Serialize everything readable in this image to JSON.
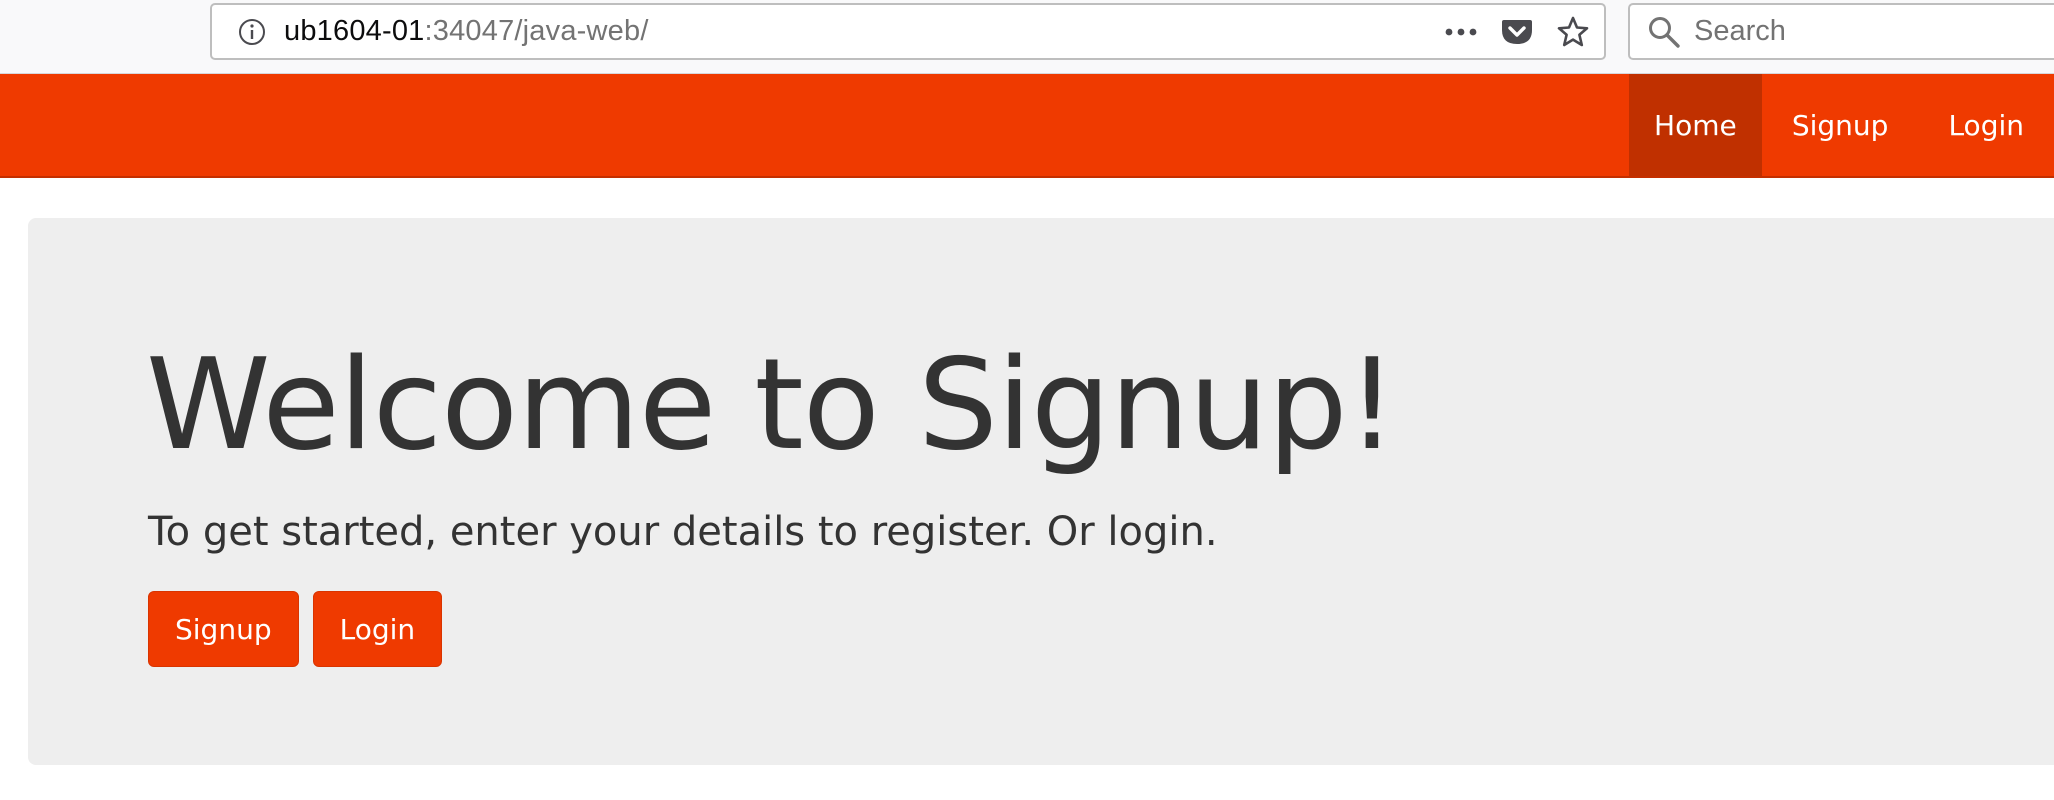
{
  "browser": {
    "url_host": "ub1604-01",
    "url_rest": ":34047/java-web/",
    "search_placeholder": "Search",
    "icons": {
      "info": "info-icon",
      "more": "more-actions-icon",
      "pocket": "pocket-icon",
      "bookmark": "bookmark-star-icon",
      "search": "search-icon"
    }
  },
  "navbar": {
    "items": [
      {
        "label": "Home",
        "active": true
      },
      {
        "label": "Signup",
        "active": false
      },
      {
        "label": "Login",
        "active": false
      }
    ]
  },
  "jumbotron": {
    "title": "Welcome to Signup!",
    "text": "To get started, enter your details to register. Or login.",
    "buttons": {
      "signup": "Signup",
      "login": "Login"
    }
  },
  "colors": {
    "brand": "#ef3a00",
    "brand_active": "#c03000",
    "jumbotron_bg": "#eeeeee",
    "text": "#333333"
  }
}
